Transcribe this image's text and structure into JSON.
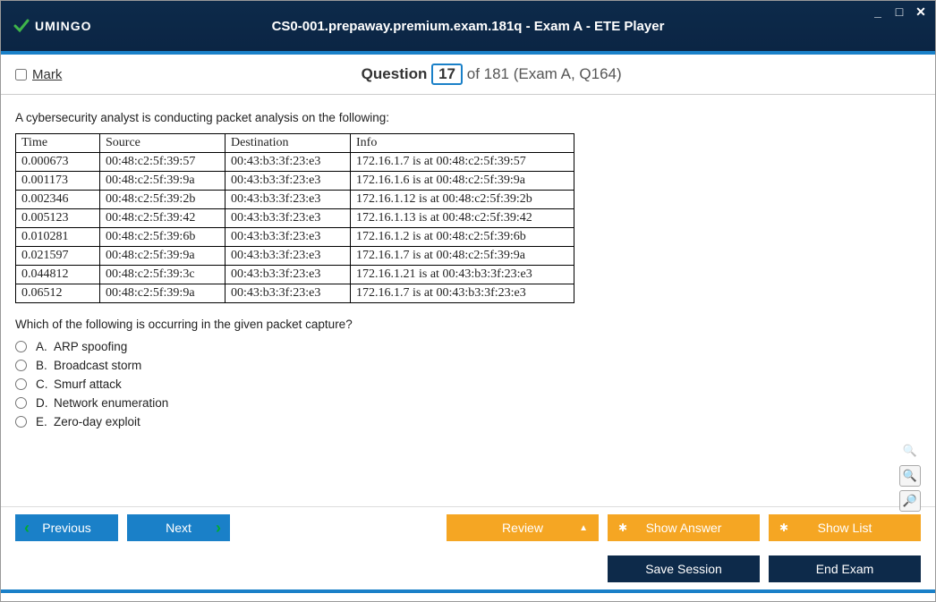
{
  "window": {
    "title": "CS0-001.prepaway.premium.exam.181q - Exam A - ETE Player",
    "logo_text": "UMINGO"
  },
  "header": {
    "mark_label": "Mark",
    "question_word": "Question",
    "current": "17",
    "of_text": "of 181 (Exam A, Q164)"
  },
  "question": {
    "stem": "A cybersecurity analyst is conducting packet analysis on the following:",
    "followup": "Which of the following is occurring in the given packet capture?",
    "table": {
      "headers": [
        "Time",
        "Source",
        "Destination",
        "Info"
      ],
      "rows": [
        [
          "0.000673",
          "00:48:c2:5f:39:57",
          "00:43:b3:3f:23:e3",
          "172.16.1.7 is at 00:48:c2:5f:39:57"
        ],
        [
          "0.001173",
          "00:48:c2:5f:39:9a",
          "00:43:b3:3f:23:e3",
          "172.16.1.6 is at 00:48:c2:5f:39:9a"
        ],
        [
          "0.002346",
          "00:48:c2:5f:39:2b",
          "00:43:b3:3f:23:e3",
          "172.16.1.12 is at 00:48:c2:5f:39:2b"
        ],
        [
          "0.005123",
          "00:48:c2:5f:39:42",
          "00:43:b3:3f:23:e3",
          "172.16.1.13 is at 00:48:c2:5f:39:42"
        ],
        [
          "0.010281",
          "00:48:c2:5f:39:6b",
          "00:43:b3:3f:23:e3",
          "172.16.1.2 is at 00:48:c2:5f:39:6b"
        ],
        [
          "0.021597",
          "00:48:c2:5f:39:9a",
          "00:43:b3:3f:23:e3",
          "172.16.1.7 is at 00:48:c2:5f:39:9a"
        ],
        [
          "0.044812",
          "00:48:c2:5f:39:3c",
          "00:43:b3:3f:23:e3",
          "172.16.1.21 is at 00:43:b3:3f:23:e3"
        ],
        [
          "0.06512",
          "00:48:c2:5f:39:9a",
          "00:43:b3:3f:23:e3",
          "172.16.1.7 is at 00:43:b3:3f:23:e3"
        ]
      ]
    },
    "options": [
      {
        "letter": "A.",
        "text": "ARP spoofing"
      },
      {
        "letter": "B.",
        "text": "Broadcast storm"
      },
      {
        "letter": "C.",
        "text": "Smurf attack"
      },
      {
        "letter": "D.",
        "text": "Network enumeration"
      },
      {
        "letter": "E.",
        "text": "Zero-day exploit"
      }
    ]
  },
  "buttons": {
    "previous": "Previous",
    "next": "Next",
    "review": "Review",
    "show_answer": "Show Answer",
    "show_list": "Show List",
    "save_session": "Save Session",
    "end_exam": "End Exam"
  }
}
